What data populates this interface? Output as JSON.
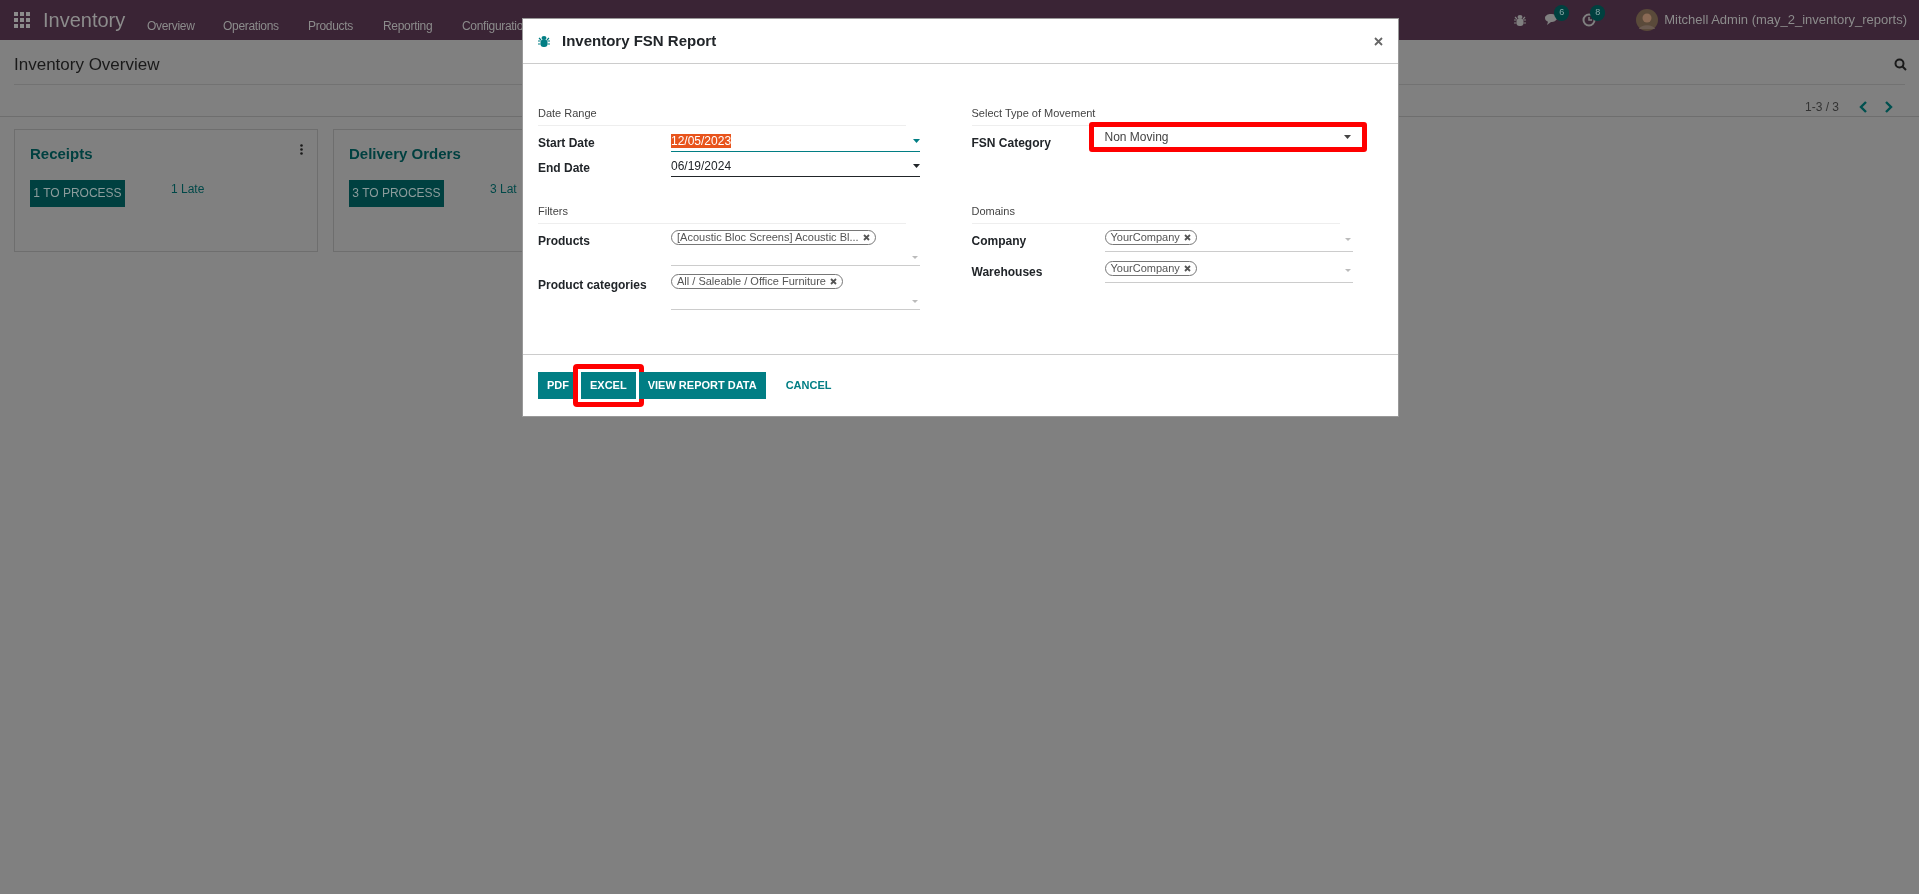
{
  "navbar": {
    "app_name": "Inventory",
    "menu": [
      "Overview",
      "Operations",
      "Products",
      "Reporting",
      "Configuratio"
    ],
    "chat_badge": "6",
    "activity_badge": "8",
    "user": "Mitchell Admin (may_2_inventory_reports)"
  },
  "control_panel": {
    "title": "Inventory Overview",
    "pager": "1-3 / 3"
  },
  "cards": [
    {
      "title": "Receipts",
      "button": "1 TO PROCESS",
      "late": "1 Late",
      "menu": true
    },
    {
      "title": "Delivery Orders",
      "button": "3 TO PROCESS",
      "late": "3 Lat",
      "menu": false
    }
  ],
  "dialog": {
    "title": "Inventory FSN Report",
    "sections": [
      {
        "heading": "Date Range",
        "fields": [
          {
            "label": "Start Date",
            "kind": "date",
            "value": "12/05/2023",
            "selected": true
          },
          {
            "label": "End Date",
            "kind": "date",
            "value": "06/19/2024",
            "selected": false
          }
        ]
      },
      {
        "heading": "Select Type of Movement",
        "fields": [
          {
            "label": "FSN Category",
            "kind": "select",
            "value": "Non Moving",
            "highlighted": true
          }
        ]
      },
      {
        "heading": "Filters",
        "fields": [
          {
            "label": "Products",
            "kind": "tags",
            "tags": [
              "[Acoustic Bloc Screens] Acoustic Bl..."
            ]
          },
          {
            "label": "Product categories",
            "kind": "tags",
            "tags": [
              "All / Saleable / Office Furniture"
            ]
          }
        ]
      },
      {
        "heading": "Domains",
        "fields": [
          {
            "label": "Company",
            "kind": "tags",
            "tags": [
              "YourCompany"
            ]
          },
          {
            "label": "Warehouses",
            "kind": "tags",
            "tags": [
              "YourCompany"
            ]
          }
        ]
      }
    ],
    "buttons": [
      {
        "label": "PDF",
        "kind": "primary",
        "highlighted": false
      },
      {
        "label": "EXCEL",
        "kind": "primary",
        "highlighted": true
      },
      {
        "label": "VIEW REPORT DATA",
        "kind": "primary",
        "highlighted": false
      },
      {
        "label": "CANCEL",
        "kind": "link",
        "highlighted": false
      }
    ]
  }
}
